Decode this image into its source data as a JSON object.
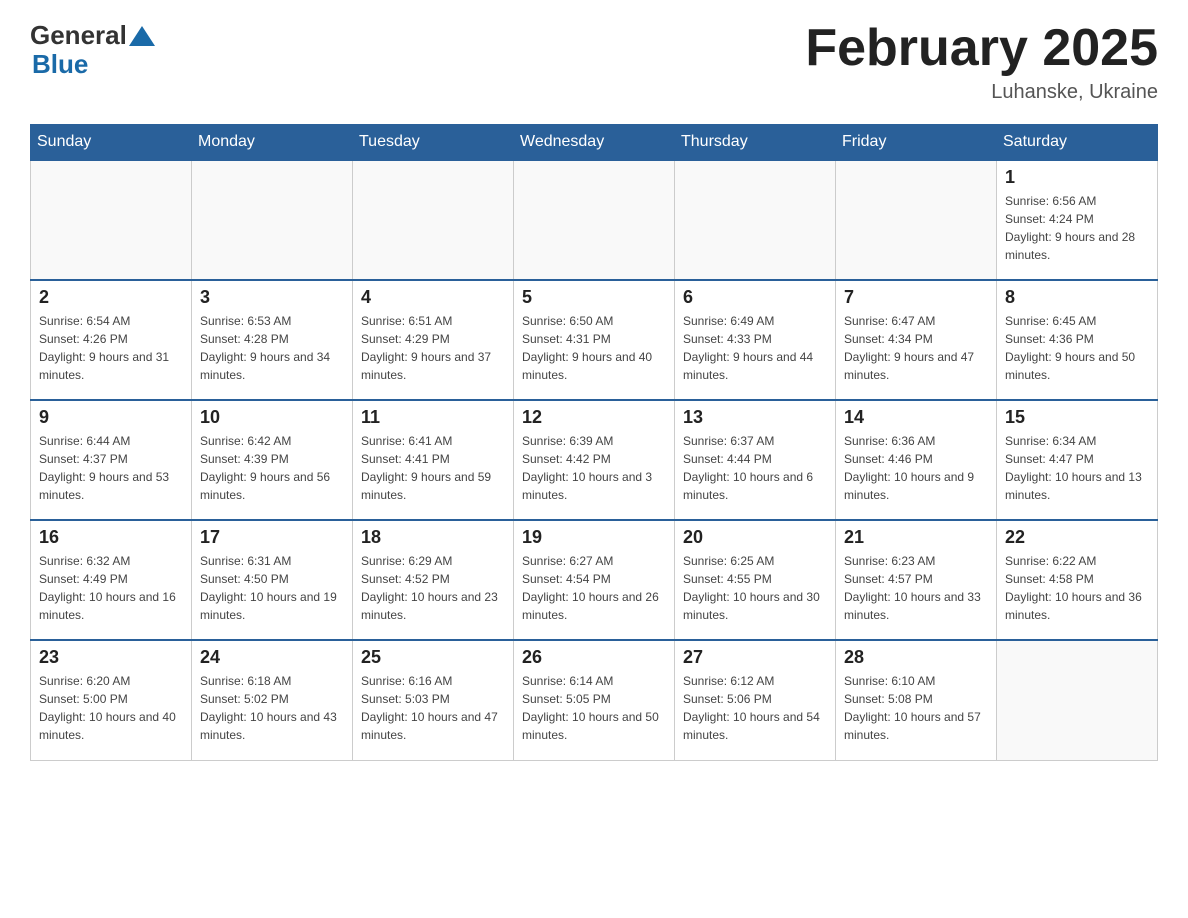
{
  "header": {
    "logo_general": "General",
    "logo_blue": "Blue",
    "month_title": "February 2025",
    "location": "Luhanske, Ukraine"
  },
  "days_of_week": [
    "Sunday",
    "Monday",
    "Tuesday",
    "Wednesday",
    "Thursday",
    "Friday",
    "Saturday"
  ],
  "weeks": [
    [
      {
        "day": "",
        "info": ""
      },
      {
        "day": "",
        "info": ""
      },
      {
        "day": "",
        "info": ""
      },
      {
        "day": "",
        "info": ""
      },
      {
        "day": "",
        "info": ""
      },
      {
        "day": "",
        "info": ""
      },
      {
        "day": "1",
        "info": "Sunrise: 6:56 AM\nSunset: 4:24 PM\nDaylight: 9 hours and 28 minutes."
      }
    ],
    [
      {
        "day": "2",
        "info": "Sunrise: 6:54 AM\nSunset: 4:26 PM\nDaylight: 9 hours and 31 minutes."
      },
      {
        "day": "3",
        "info": "Sunrise: 6:53 AM\nSunset: 4:28 PM\nDaylight: 9 hours and 34 minutes."
      },
      {
        "day": "4",
        "info": "Sunrise: 6:51 AM\nSunset: 4:29 PM\nDaylight: 9 hours and 37 minutes."
      },
      {
        "day": "5",
        "info": "Sunrise: 6:50 AM\nSunset: 4:31 PM\nDaylight: 9 hours and 40 minutes."
      },
      {
        "day": "6",
        "info": "Sunrise: 6:49 AM\nSunset: 4:33 PM\nDaylight: 9 hours and 44 minutes."
      },
      {
        "day": "7",
        "info": "Sunrise: 6:47 AM\nSunset: 4:34 PM\nDaylight: 9 hours and 47 minutes."
      },
      {
        "day": "8",
        "info": "Sunrise: 6:45 AM\nSunset: 4:36 PM\nDaylight: 9 hours and 50 minutes."
      }
    ],
    [
      {
        "day": "9",
        "info": "Sunrise: 6:44 AM\nSunset: 4:37 PM\nDaylight: 9 hours and 53 minutes."
      },
      {
        "day": "10",
        "info": "Sunrise: 6:42 AM\nSunset: 4:39 PM\nDaylight: 9 hours and 56 minutes."
      },
      {
        "day": "11",
        "info": "Sunrise: 6:41 AM\nSunset: 4:41 PM\nDaylight: 9 hours and 59 minutes."
      },
      {
        "day": "12",
        "info": "Sunrise: 6:39 AM\nSunset: 4:42 PM\nDaylight: 10 hours and 3 minutes."
      },
      {
        "day": "13",
        "info": "Sunrise: 6:37 AM\nSunset: 4:44 PM\nDaylight: 10 hours and 6 minutes."
      },
      {
        "day": "14",
        "info": "Sunrise: 6:36 AM\nSunset: 4:46 PM\nDaylight: 10 hours and 9 minutes."
      },
      {
        "day": "15",
        "info": "Sunrise: 6:34 AM\nSunset: 4:47 PM\nDaylight: 10 hours and 13 minutes."
      }
    ],
    [
      {
        "day": "16",
        "info": "Sunrise: 6:32 AM\nSunset: 4:49 PM\nDaylight: 10 hours and 16 minutes."
      },
      {
        "day": "17",
        "info": "Sunrise: 6:31 AM\nSunset: 4:50 PM\nDaylight: 10 hours and 19 minutes."
      },
      {
        "day": "18",
        "info": "Sunrise: 6:29 AM\nSunset: 4:52 PM\nDaylight: 10 hours and 23 minutes."
      },
      {
        "day": "19",
        "info": "Sunrise: 6:27 AM\nSunset: 4:54 PM\nDaylight: 10 hours and 26 minutes."
      },
      {
        "day": "20",
        "info": "Sunrise: 6:25 AM\nSunset: 4:55 PM\nDaylight: 10 hours and 30 minutes."
      },
      {
        "day": "21",
        "info": "Sunrise: 6:23 AM\nSunset: 4:57 PM\nDaylight: 10 hours and 33 minutes."
      },
      {
        "day": "22",
        "info": "Sunrise: 6:22 AM\nSunset: 4:58 PM\nDaylight: 10 hours and 36 minutes."
      }
    ],
    [
      {
        "day": "23",
        "info": "Sunrise: 6:20 AM\nSunset: 5:00 PM\nDaylight: 10 hours and 40 minutes."
      },
      {
        "day": "24",
        "info": "Sunrise: 6:18 AM\nSunset: 5:02 PM\nDaylight: 10 hours and 43 minutes."
      },
      {
        "day": "25",
        "info": "Sunrise: 6:16 AM\nSunset: 5:03 PM\nDaylight: 10 hours and 47 minutes."
      },
      {
        "day": "26",
        "info": "Sunrise: 6:14 AM\nSunset: 5:05 PM\nDaylight: 10 hours and 50 minutes."
      },
      {
        "day": "27",
        "info": "Sunrise: 6:12 AM\nSunset: 5:06 PM\nDaylight: 10 hours and 54 minutes."
      },
      {
        "day": "28",
        "info": "Sunrise: 6:10 AM\nSunset: 5:08 PM\nDaylight: 10 hours and 57 minutes."
      },
      {
        "day": "",
        "info": ""
      }
    ]
  ]
}
